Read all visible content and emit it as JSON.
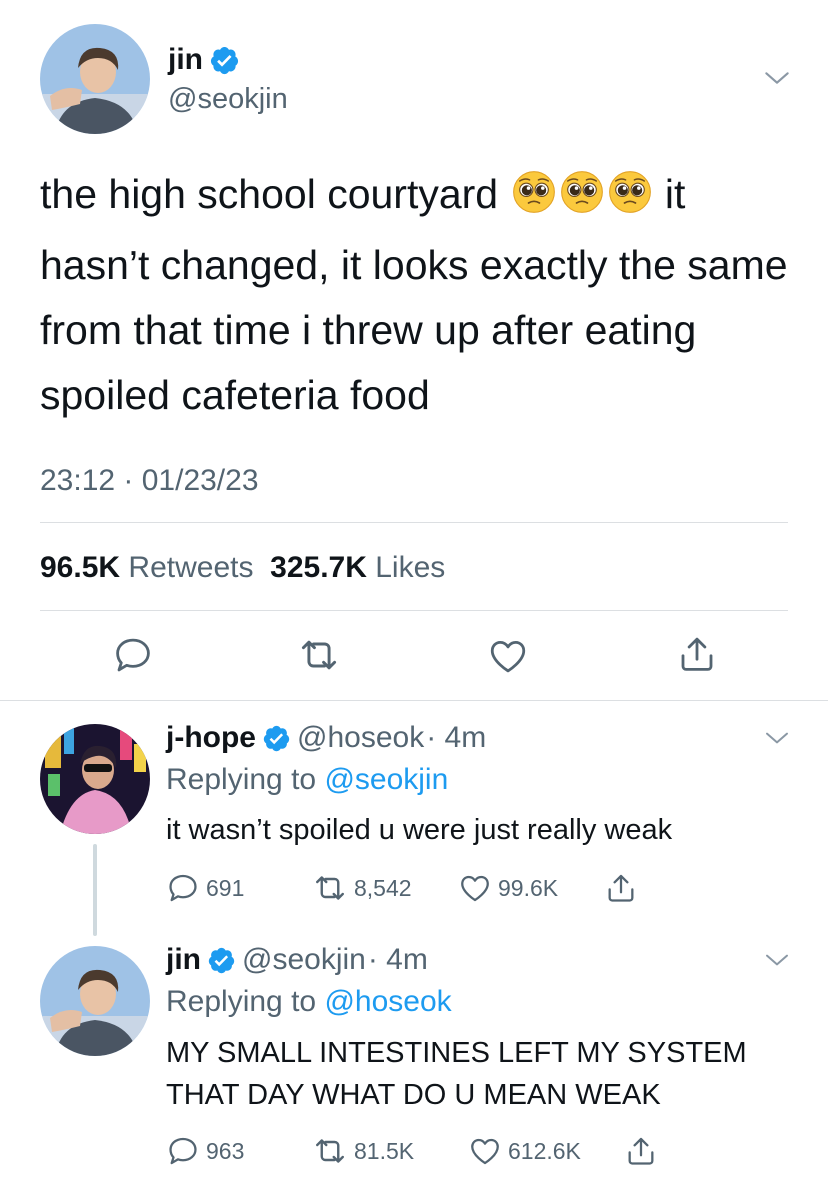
{
  "colors": {
    "accent": "#1d9bf0",
    "muted": "#536471",
    "text": "#0f1419",
    "divider": "#dcdfe2"
  },
  "main_tweet": {
    "display_name": "jin",
    "handle": "@seokjin",
    "verified_icon": "verified-badge-icon",
    "text_parts": [
      "the high school courtyard",
      "it hasn’t changed, it looks exactly the same from that time i threw up after eating spoiled cafeteria food"
    ],
    "emojis": [
      "pleading-face-emoji",
      "pleading-face-emoji",
      "pleading-face-emoji"
    ],
    "timestamp": "23:12 · 01/23/23",
    "retweets_count": "96.5K",
    "retweets_label": "Retweets",
    "likes_count": "325.7K",
    "likes_label": "Likes",
    "actions": [
      "reply-icon",
      "retweet-icon",
      "like-icon",
      "share-icon"
    ]
  },
  "replies": [
    {
      "display_name": "j-hope",
      "handle": "@hoseok",
      "time": "· 4m",
      "replying_prefix": "Replying to",
      "replying_to": "@seokjin",
      "text": "it wasn’t spoiled u were just really weak",
      "reply_count": "691",
      "retweet_count": "8,542",
      "like_count": "99.6K"
    },
    {
      "display_name": "jin",
      "handle": "@seokjin",
      "time": "· 4m",
      "replying_prefix": "Replying to",
      "replying_to": "@hoseok",
      "text": "MY SMALL INTESTINES LEFT MY SYSTEM THAT DAY WHAT DO U MEAN WEAK",
      "reply_count": "963",
      "retweet_count": "81.5K",
      "like_count": "612.6K"
    }
  ]
}
